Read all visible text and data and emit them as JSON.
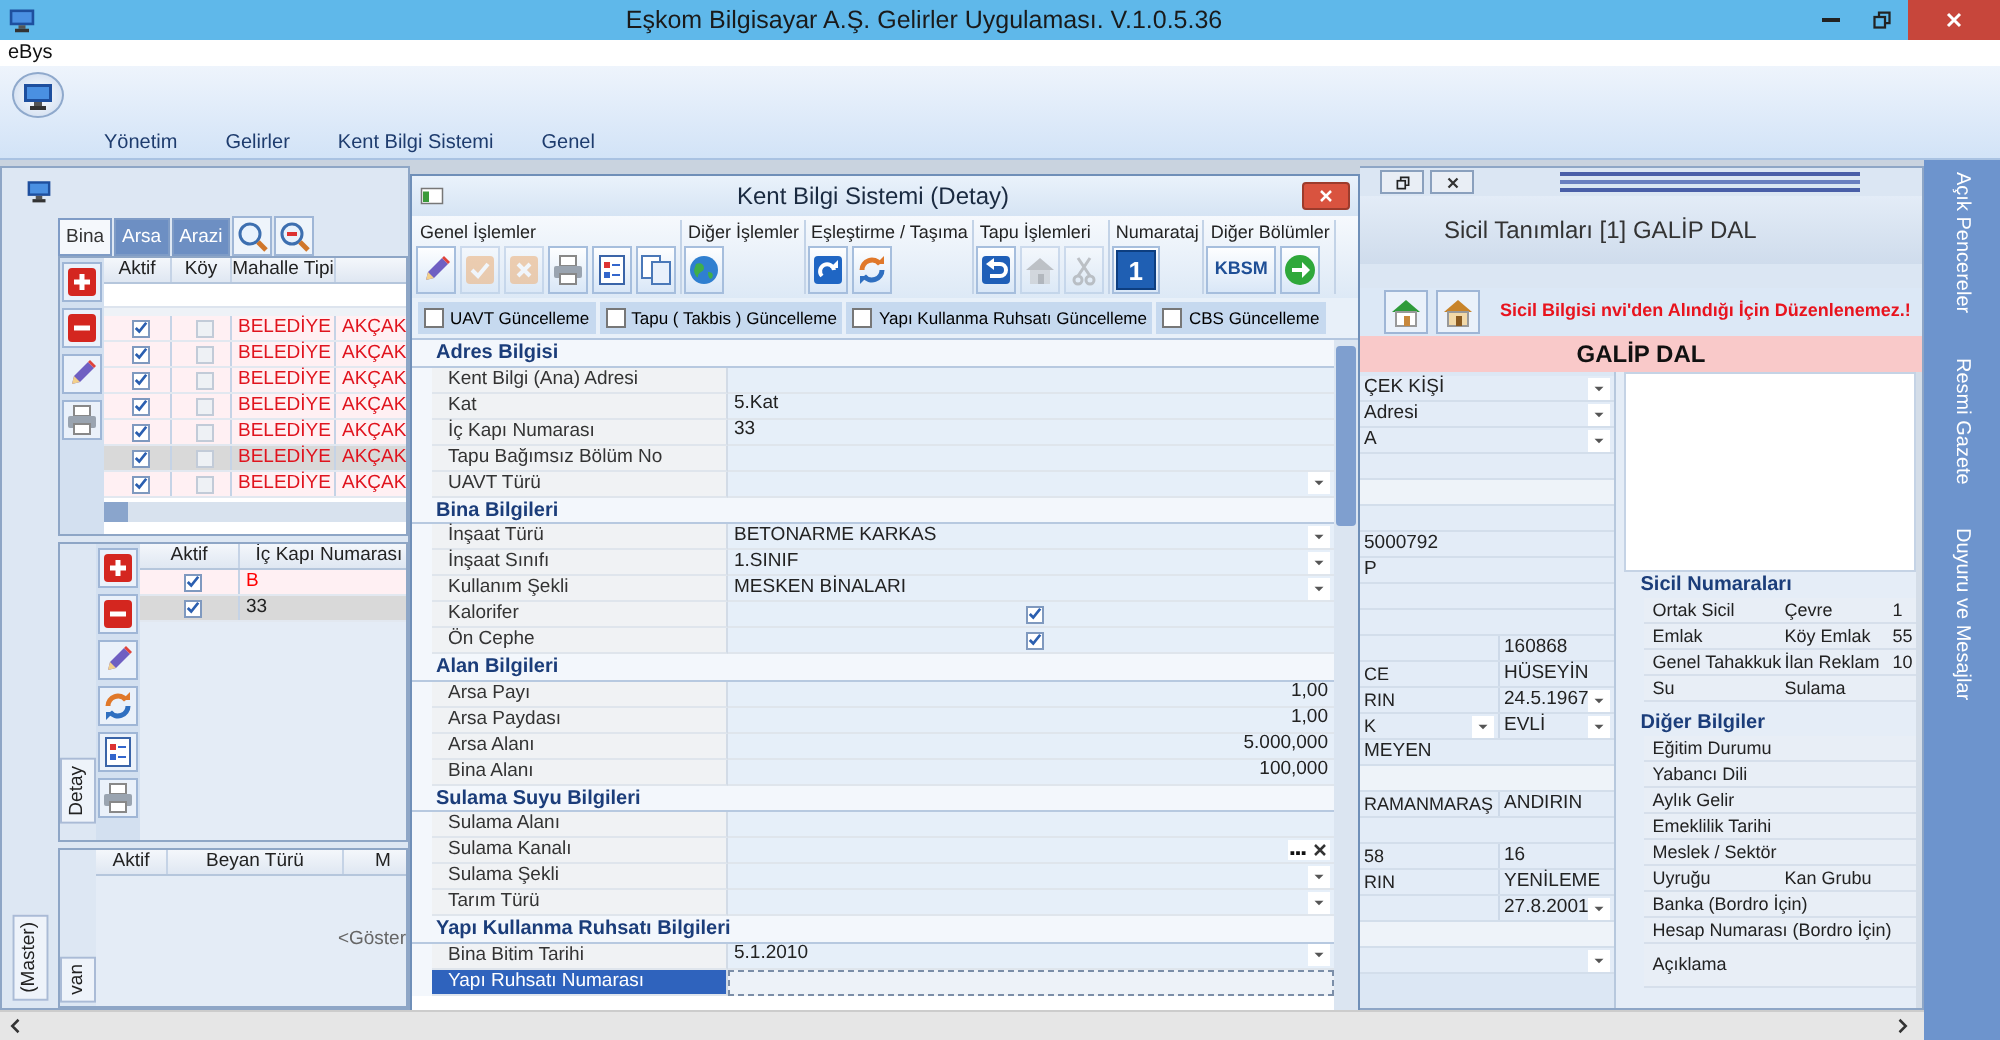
{
  "window": {
    "title": "Eşkom Bilgisayar A.Ş. Gelirler Uygulaması. V.1.0.5.36"
  },
  "menu": [
    "eBys"
  ],
  "ribbon_tabs": [
    "Yönetim",
    "Gelirler",
    "Kent Bilgi Sistemi",
    "Genel"
  ],
  "side_tabs": [
    "Açık Pencereler",
    "Resmi Gazete",
    "Duyuru ve Mesajlar"
  ],
  "left_window": {
    "tabs": [
      {
        "label": "Bina",
        "selected": true
      },
      {
        "label": "Arsa",
        "selected": false
      },
      {
        "label": "Arazi",
        "selected": false
      }
    ],
    "master_grid": {
      "columns": [
        "Aktif",
        "Köy",
        "Mahalle Tipi"
      ],
      "rows": [
        {
          "aktif": true,
          "koy": false,
          "mahalle_tipi": "BELEDİYE",
          "column_4": "AKÇAK",
          "selected": false
        },
        {
          "aktif": true,
          "koy": false,
          "mahalle_tipi": "BELEDİYE",
          "column_4": "AKÇAK",
          "selected": false
        },
        {
          "aktif": true,
          "koy": false,
          "mahalle_tipi": "BELEDİYE",
          "column_4": "AKÇAK",
          "selected": false
        },
        {
          "aktif": true,
          "koy": false,
          "mahalle_tipi": "BELEDİYE",
          "column_4": "AKÇAK",
          "selected": false
        },
        {
          "aktif": true,
          "koy": false,
          "mahalle_tipi": "BELEDİYE",
          "column_4": "AKÇAK",
          "selected": false
        },
        {
          "aktif": true,
          "koy": false,
          "mahalle_tipi": "BELEDİYE",
          "column_4": "AKÇAK",
          "selected": true
        },
        {
          "aktif": true,
          "koy": false,
          "mahalle_tipi": "BELEDİYE",
          "column_4": "AKÇAK",
          "selected": false
        }
      ]
    },
    "detail_tab": "Detay",
    "detail_grid": {
      "columns": [
        "Aktif",
        "İç Kapı Numarası"
      ],
      "rows": [
        {
          "aktif": true,
          "ic_kapi_numarasi": "B",
          "color": "#ff0000",
          "selected": false
        },
        {
          "aktif": true,
          "ic_kapi_numarasi": "33",
          "color": "#222222",
          "selected": true
        }
      ]
    },
    "beyan_grid": {
      "columns": [
        "Aktif",
        "Beyan Türü",
        "M"
      ],
      "empty_text": "<Göster"
    },
    "bottom_tabs": [
      "(Master)",
      "van"
    ]
  },
  "dialog": {
    "title": "Kent Bilgi Sistemi (Detay)",
    "groups": [
      {
        "label": "Genel İşlemler",
        "buttons": [
          {
            "kind": "pencil",
            "disabled": false
          },
          {
            "kind": "check",
            "disabled": true
          },
          {
            "kind": "cross",
            "disabled": true
          },
          {
            "kind": "printer",
            "disabled": false
          },
          {
            "kind": "checklist",
            "disabled": false
          },
          {
            "kind": "copy",
            "disabled": false
          }
        ]
      },
      {
        "label": "Diğer İşlemler",
        "buttons": [
          {
            "kind": "globe",
            "disabled": false
          }
        ]
      },
      {
        "label": "Eşleştirme / Taşıma",
        "buttons": [
          {
            "kind": "redo",
            "disabled": false
          },
          {
            "kind": "sync",
            "disabled": false
          }
        ]
      },
      {
        "label": "Tapu İşlemleri",
        "buttons": [
          {
            "kind": "undo",
            "disabled": false
          },
          {
            "kind": "house",
            "disabled": true
          },
          {
            "kind": "scissors",
            "disabled": true
          }
        ]
      },
      {
        "label": "Numarataj",
        "buttons": [
          {
            "kind": "number",
            "text": "1",
            "disabled": false
          }
        ]
      },
      {
        "label": "Diğer Bölümler",
        "buttons": [
          {
            "kind": "label",
            "text": "KBSM",
            "disabled": false
          },
          {
            "kind": "arrow",
            "disabled": false
          }
        ]
      }
    ],
    "update_checks": [
      {
        "label": "UAVT Güncelleme",
        "checked": false
      },
      {
        "label": "Tapu ( Takbis ) Güncelleme",
        "checked": false
      },
      {
        "label": "Yapı Kullanma Ruhsatı Güncelleme",
        "checked": false
      },
      {
        "label": "CBS Güncelleme",
        "checked": false
      }
    ],
    "property_grid": [
      {
        "title": "Adres Bilgisi",
        "rows": [
          {
            "label": "Kent Bilgi (Ana) Adresi",
            "kind": "text",
            "selected": false
          },
          {
            "label": "Kat",
            "kind": "text",
            "value": "5.Kat",
            "selected": false
          },
          {
            "label": "İç Kapı Numarası",
            "kind": "text",
            "value": "33",
            "selected": false
          },
          {
            "label": "Tapu Bağımsız Bölüm No",
            "kind": "text",
            "selected": false
          },
          {
            "label": "UAVT Türü",
            "kind": "combo",
            "selected": false
          }
        ]
      },
      {
        "title": "Bina Bilgileri",
        "rows": [
          {
            "label": "İnşaat Türü",
            "kind": "combo",
            "value": "BETONARME KARKAS",
            "selected": false
          },
          {
            "label": "İnşaat Sınıfı",
            "kind": "combo",
            "value": "1.SINIF",
            "selected": false
          },
          {
            "label": "Kullanım Şekli",
            "kind": "combo",
            "value": "MESKEN BİNALARI",
            "selected": false
          },
          {
            "label": "Kalorifer",
            "kind": "check",
            "checked": true,
            "selected": false
          },
          {
            "label": "Ön Cephe",
            "kind": "check",
            "checked": true,
            "selected": false
          }
        ]
      },
      {
        "title": "Alan Bilgileri",
        "rows": [
          {
            "label": "Arsa Payı",
            "kind": "number",
            "value": "1,00",
            "selected": false
          },
          {
            "label": "Arsa Paydası",
            "kind": "number",
            "value": "1,00",
            "selected": false
          },
          {
            "label": "Arsa Alanı",
            "kind": "number",
            "value": "5.000,000",
            "selected": false
          },
          {
            "label": "Bina Alanı",
            "kind": "number",
            "value": "100,000",
            "selected": false
          }
        ]
      },
      {
        "title": "Sulama Suyu Bilgileri",
        "rows": [
          {
            "label": "Sulama Alanı",
            "kind": "text",
            "selected": false
          },
          {
            "label": "Sulama Kanalı",
            "kind": "lookup",
            "selected": false
          },
          {
            "label": "Sulama Şekli",
            "kind": "combo",
            "selected": false
          },
          {
            "label": "Tarım Türü",
            "kind": "combo",
            "selected": false
          }
        ]
      },
      {
        "title": "Yapı Kullanma Ruhsatı Bilgileri",
        "rows": [
          {
            "label": "Bina Bitim Tarihi",
            "kind": "combo",
            "value": "5.1.2010",
            "selected": false
          },
          {
            "label": "Yapı Ruhsatı Numarası",
            "kind": "text",
            "selected": true
          }
        ]
      }
    ]
  },
  "sicil_window": {
    "title": "Sicil Tanımları [1] GALİP DAL",
    "warning": "Sicil Bilgisi nvi'den Alındığı İçin Düzenlenemez.!",
    "name_banner": "GALİP DAL",
    "fields": [
      {
        "kind": "full",
        "cell": {
          "text": "ÇEK KİŞİ",
          "dropdown": true
        }
      },
      {
        "kind": "full",
        "cell": {
          "text": "Adresi",
          "dropdown": true
        }
      },
      {
        "kind": "full",
        "cell": {
          "text": "A",
          "dropdown": true
        }
      },
      {
        "kind": "blank"
      },
      {
        "kind": "band"
      },
      {
        "kind": "blank"
      },
      {
        "kind": "full",
        "cell": {
          "text": "5000792",
          "dropdown": false
        }
      },
      {
        "kind": "full",
        "cell": {
          "text": "P",
          "dropdown": false
        }
      },
      {
        "kind": "blank"
      },
      {
        "kind": "blank"
      },
      {
        "kind": "pair",
        "right": {
          "text": "160868",
          "dropdown": false
        }
      },
      {
        "kind": "pair",
        "left": {
          "text": "CE",
          "dropdown": false
        },
        "right": {
          "text": "HÜSEYİN",
          "dropdown": false
        }
      },
      {
        "kind": "pair",
        "left": {
          "text": "RIN",
          "dropdown": false
        },
        "right": {
          "text": "24.5.1967",
          "dropdown": true
        }
      },
      {
        "kind": "pair",
        "left": {
          "text": "K",
          "dropdown": true
        },
        "right": {
          "text": "EVLİ",
          "dropdown": true
        }
      },
      {
        "kind": "full",
        "cell": {
          "text": "MEYEN",
          "dropdown": false
        }
      },
      {
        "kind": "band"
      },
      {
        "kind": "pair",
        "left": {
          "text": "RAMANMARAŞ",
          "dropdown": false
        },
        "right": {
          "text": "ANDIRIN",
          "dropdown": false
        }
      },
      {
        "kind": "blank"
      },
      {
        "kind": "pair",
        "left": {
          "text": "58",
          "dropdown": false
        },
        "right": {
          "text": "16",
          "dropdown": false
        }
      },
      {
        "kind": "pair",
        "left": {
          "text": "RIN",
          "dropdown": false
        },
        "right": {
          "text": "YENİLEME",
          "dropdown": false
        }
      },
      {
        "kind": "pair",
        "right": {
          "text": "27.8.2001",
          "dropdown": true
        }
      },
      {
        "kind": "band"
      },
      {
        "kind": "full",
        "cell": {
          "dropdown": true
        }
      }
    ],
    "sicil_numaralari": {
      "title": "Sicil Numaraları",
      "rows": [
        [
          "Ortak Sicil",
          "Çevre",
          "1"
        ],
        [
          "Emlak",
          "Köy Emlak",
          "55"
        ],
        [
          "Genel Tahakkuk",
          "İlan Reklam",
          "10"
        ],
        [
          "Su",
          "Sulama"
        ]
      ]
    },
    "diger_bilgiler": {
      "title": "Diğer Bilgiler",
      "rows": [
        [
          "Eğitim Durumu"
        ],
        [
          "Yabancı Dili"
        ],
        [
          "Aylık Gelir"
        ],
        [
          "Emeklilik Tarihi"
        ],
        [
          "Meslek / Sektör"
        ],
        [
          "Uyruğu",
          "Kan Grubu"
        ],
        [
          "Banka (Bordro İçin)"
        ],
        [
          "Hesap Numarası (Bordro İçin)"
        ],
        [
          "Açıklama"
        ]
      ]
    }
  }
}
